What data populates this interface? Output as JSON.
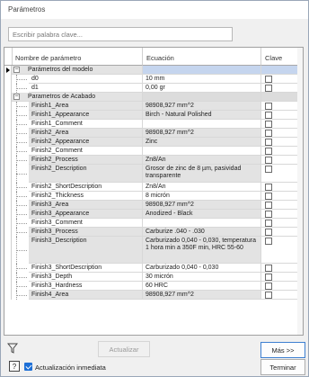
{
  "window": {
    "title": "Parámetros"
  },
  "search": {
    "placeholder": "Escribir palabra clave..."
  },
  "columns": {
    "name": "Nombre de parámetro",
    "equation": "Ecuación",
    "key": "Clave"
  },
  "sections": [
    {
      "label": "Parámetros del modelo",
      "toggle": "−"
    },
    {
      "label": "Parametros de Acabado",
      "toggle": "−"
    }
  ],
  "model_params": [
    {
      "name": "d0",
      "equation": "10 mm"
    },
    {
      "name": "d1",
      "equation": "0,00 gr"
    }
  ],
  "finish_params": [
    {
      "name": "Finish1_Area",
      "equation": "98908,927 mm^2",
      "gray": true
    },
    {
      "name": "Finish1_Appearance",
      "equation": "Birch - Natural Polished",
      "gray": true
    },
    {
      "name": "Finish1_Comment",
      "equation": "",
      "gray": false
    },
    {
      "name": "Finish2_Area",
      "equation": "98908,927 mm^2",
      "gray": true
    },
    {
      "name": "Finish2_Appearance",
      "equation": "Zinc",
      "gray": true
    },
    {
      "name": "Finish2_Comment",
      "equation": "",
      "gray": false
    },
    {
      "name": "Finish2_Process",
      "equation": "Zn8/An",
      "gray": true
    },
    {
      "name": "Finish2_Description",
      "equation": "Grosor de zinc de 8 µm, pasividad transparente",
      "gray": true,
      "tall": 2
    },
    {
      "name": "Finish2_ShortDescription",
      "equation": "Zn8/An",
      "gray": false
    },
    {
      "name": "Finish2_Thickness",
      "equation": "8 micrón",
      "gray": false
    },
    {
      "name": "Finish3_Area",
      "equation": "98908,927 mm^2",
      "gray": true
    },
    {
      "name": "Finish3_Appearance",
      "equation": "Anodized - Black",
      "gray": true
    },
    {
      "name": "Finish3_Comment",
      "equation": "",
      "gray": false
    },
    {
      "name": "Finish3_Process",
      "equation": "Carburize .040 - .030",
      "gray": true
    },
    {
      "name": "Finish3_Description",
      "equation": "Carburizado 0,040 - 0,030, temperatura 1 hora min a 350F min, HRC 55-60",
      "gray": true,
      "tall": 3
    },
    {
      "name": "Finish3_ShortDescription",
      "equation": "Carburizado 0,040 - 0,030",
      "gray": false
    },
    {
      "name": "Finish3_Depth",
      "equation": "30 micrón",
      "gray": false
    },
    {
      "name": "Finish3_Hardness",
      "equation": "60 HRC",
      "gray": false
    },
    {
      "name": "Finish4_Area",
      "equation": "98908,927 mm^2",
      "gray": true
    }
  ],
  "footer": {
    "update_label": "Actualizar",
    "more_label": "Más >>",
    "close_label": "Terminar",
    "auto_update_label": "Actualización inmediata"
  }
}
